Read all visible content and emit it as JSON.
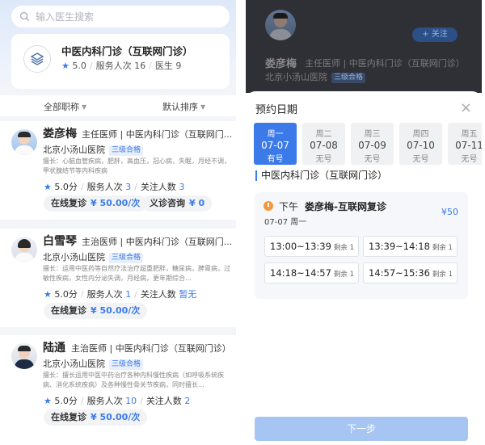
{
  "search": {
    "placeholder": "输入医生搜索"
  },
  "department": {
    "title": "中医内科门诊（互联网门诊）",
    "rating": "5.0",
    "service_label": "服务人次",
    "service_count": "16",
    "doctor_label": "医生",
    "doctor_count": "9"
  },
  "filters": {
    "title": "全部职称",
    "sort": "默认排序"
  },
  "doctors": [
    {
      "name": "娄彦梅",
      "title": "主任医师 | 中医内科门诊（互联网门...",
      "hospital": "北京小汤山医院",
      "tag": "三级合格",
      "specialty": "擅长：心脑血管疾病，肥胖，高血压，冠心病，失眠，月经不调，甲状腺结节等内科疾病",
      "rating": "5.0分",
      "service_label": "服务人次",
      "service_count": "3",
      "follow_label": "关注人数",
      "follow_count": "3",
      "chip1_label": "在线复诊",
      "chip1_price": "¥ 50.00/次",
      "chip2_label": "义诊咨询",
      "chip2_price": "¥ 0"
    },
    {
      "name": "白雪琴",
      "title": "主治医师 | 中医内科门诊（互联网门...",
      "hospital": "北京小汤山医院",
      "tag": "三级合格",
      "specialty": "擅长：运用中医药等自然疗法治疗超重肥胖，糖尿病，脾胃病，过敏性疾病，女性内分泌失调，月经病，更年期综合...",
      "rating": "5.0分",
      "service_label": "服务人次",
      "service_count": "1",
      "follow_label": "关注人数",
      "follow_count": "暂无",
      "chip1_label": "在线复诊",
      "chip1_price": "¥ 50.00/次"
    },
    {
      "name": "陆通",
      "title": "主治医师 | 中医内科门诊（互联网门诊）",
      "hospital": "北京小汤山医院",
      "tag": "三级合格",
      "specialty": "擅长：擅长运用中医中药治疗各种内科慢性疾病（如呼吸系统疾病、消化系统疾病）及各种慢性骨关节疾病，同时擅长...",
      "rating": "5.0分",
      "service_label": "服务人次",
      "service_count": "10",
      "follow_label": "关注人数",
      "follow_count": "2",
      "chip1_label": "在线复诊",
      "chip1_price": "¥ 50.00/次"
    }
  ],
  "profile": {
    "name": "娄彦梅",
    "title": "主任医师 | 中医内科门诊（互联网门诊）",
    "hospital": "北京小汤山医院",
    "tag": "三级合格",
    "follow_button": "+ 关注"
  },
  "booking": {
    "title": "预约日期",
    "close": "×",
    "dates": [
      {
        "weekday": "周一",
        "date": "07-07",
        "status": "有号"
      },
      {
        "weekday": "周二",
        "date": "07-08",
        "status": "无号"
      },
      {
        "weekday": "周三",
        "date": "07-09",
        "status": "无号"
      },
      {
        "weekday": "周四",
        "date": "07-10",
        "status": "无号"
      },
      {
        "weekday": "周五",
        "date": "07-11",
        "status": "无号"
      }
    ],
    "section": "中医内科门诊（互联网门诊）",
    "period": "下午",
    "service": "娄彦梅-互联网复诊",
    "price": "¥50",
    "slot_date": "07-07  周一",
    "slots": [
      {
        "time": "13:00~13:39",
        "remain": "剩余 1"
      },
      {
        "time": "13:39~14:18",
        "remain": "剩余 1"
      },
      {
        "time": "14:18~14:57",
        "remain": "剩余 1"
      },
      {
        "time": "14:57~15:36",
        "remain": "剩余 1"
      }
    ],
    "next": "下一步"
  },
  "colors": {
    "accent": "#3b7ae8",
    "orange": "#f4983a"
  }
}
